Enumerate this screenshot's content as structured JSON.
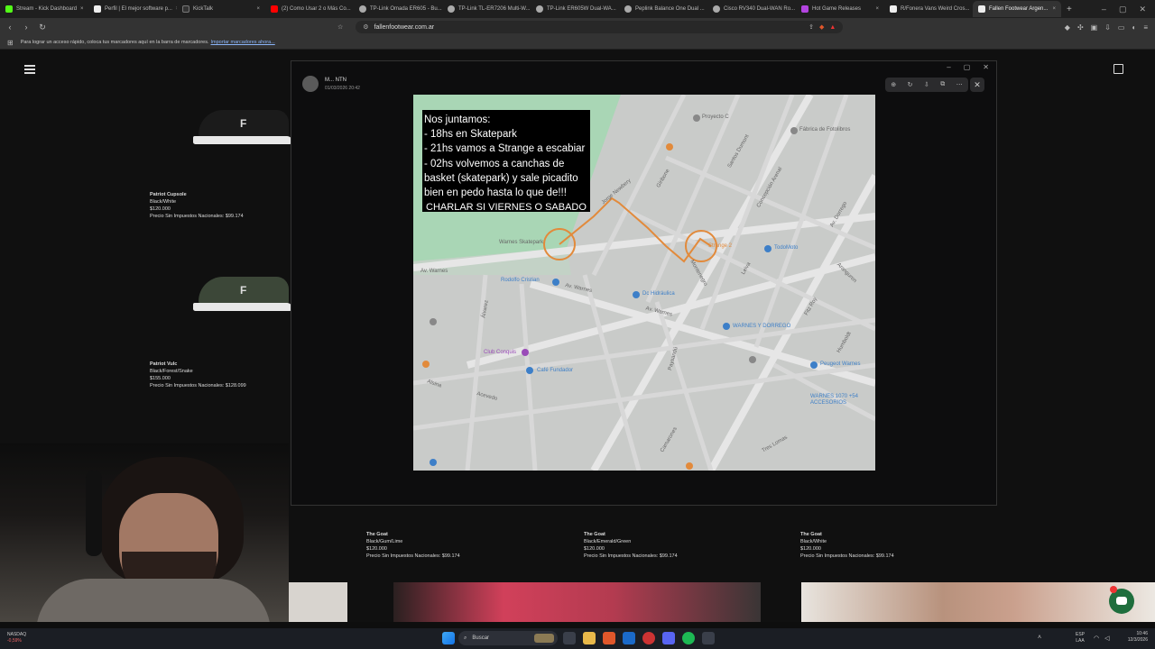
{
  "browser": {
    "tabs": [
      {
        "label": "Stream - Kick Dashboard",
        "color": "#53fc18"
      },
      {
        "label": "Perfil | El mejor software p...",
        "color": "#eeeeee"
      },
      {
        "label": "KickTalk",
        "color": "#333333"
      },
      {
        "label": "(2) Como Usar 2 o Más Co...",
        "color": "#ff0000"
      },
      {
        "label": "TP-Link Omada ER605 - Bu...",
        "color": "#aaaaaa"
      },
      {
        "label": "TP-Link TL-ER7206 Multi-W...",
        "color": "#aaaaaa"
      },
      {
        "label": "TP-Link ER605W Dual-WA...",
        "color": "#aaaaaa"
      },
      {
        "label": "Peplink Balance One Dual ...",
        "color": "#aaaaaa"
      },
      {
        "label": "Cisco RV340 Dual-WAN Ro...",
        "color": "#aaaaaa"
      },
      {
        "label": "Hot Game Releases",
        "color": "#b344e0"
      },
      {
        "label": "R/Fonera Vans Weird Cros...",
        "color": "#eeeeee"
      },
      {
        "label": "Fallen Footwear Argen...",
        "color": "#eeeeee"
      }
    ],
    "url": "fallenfootwear.com.ar",
    "bookmarks_hint": "Para lograr un acceso rápido, coloca tus marcadores aquí en la barra de marcadores.",
    "bookmarks_link": "Importar marcadores ahora..."
  },
  "products_left": [
    {
      "name": "Patriot Cupsole",
      "color": "Black/White",
      "price": "$120.000",
      "tax": "Precio Sin Impuestos Nacionales: $99.174"
    },
    {
      "name": "Patriot Vulc",
      "color": "Black/Forest/Snake",
      "price": "$155.000",
      "tax": "Precio Sin Impuestos Nacionales: $128.099"
    }
  ],
  "products_row": [
    {
      "name": "The Goat",
      "color": "Black/Gum/Lime",
      "price": "$120.000",
      "tax": "Precio Sin Impuestos Nacionales: $99.174"
    },
    {
      "name": "The Goat",
      "color": "Black/Emerald/Green",
      "price": "$120.000",
      "tax": "Precio Sin Impuestos Nacionales: $99.174"
    },
    {
      "name": "The Goat",
      "color": "Black/White",
      "price": "$120.000",
      "tax": "Precio Sin Impuestos Nacionales: $99.174"
    }
  ],
  "popup": {
    "user": "M... NTN",
    "time": "01/03/2026 20:42",
    "note_lines": [
      "Nos juntamos:",
      "- 18hs en Skatepark",
      "- 21hs vamos a Strange a escabiar",
      "- 02hs volvemos a canchas de",
      "basket (skatepark) y sale picadito",
      "bien en pedo hasta lo que de!!!",
      "CHARLAR SI VIERNES O SABADO"
    ],
    "map_labels": {
      "proyecto": "Proyecto C",
      "fabrica": "Fábrica de Fotolibros",
      "warnes_skate": "Warnes Skatepark",
      "strange": "Strange 2",
      "todo": "TodoMoto",
      "rodolfo": "Rodolfo Cristian",
      "hidraulica": "Dc Hidráulica",
      "warnes_dorrego": "WARNES Y DORREGO",
      "club": "Club Conquis",
      "cafe": "Café Fundador",
      "peugeot": "Peugeot Warnes",
      "warnes1070": "WARNES 1070 +54 ACCESORIOS",
      "av_warnes": "Av. Warnes",
      "av_warnes2": "Av. Warnes",
      "av_warnes3": "Av. Warnes",
      "av_dorrego": "Av. Dorrego",
      "fitz": "Fitz Roy",
      "humboldt": "Humboldt",
      "aranguren": "Aranguren",
      "giribone": "Giribone",
      "santos": "Santos Dumont",
      "concepcion": "Concepción Arenal",
      "leiva": "Leiva",
      "paysandu": "Paysandú",
      "alvarez": "Álvarez",
      "camarones": "Camarones",
      "acevedo": "Acevedo",
      "alsina": "Alsina",
      "mantenegro": "Montenegro",
      "lomas": "Tres Lomas",
      "newbery": "Jorge Newbery"
    }
  },
  "taskbar": {
    "ticker_name": "NASDAQ",
    "ticker_value": "-0,59%",
    "search": "Buscar",
    "lang": "ESP",
    "lang2": "LAA",
    "time": "10:46",
    "date": "12/3/2026"
  }
}
